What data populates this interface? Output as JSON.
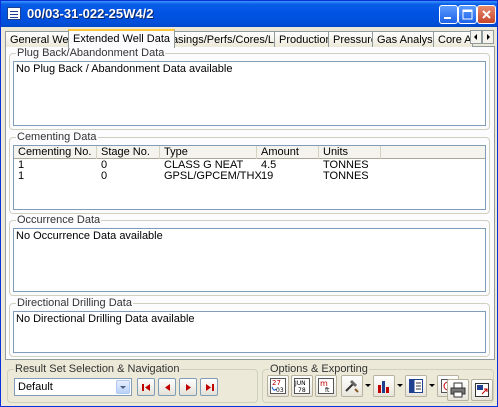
{
  "window": {
    "title": "00/03-31-022-25W4/2"
  },
  "tabs": [
    {
      "label": "General Well"
    },
    {
      "label": "Extended Well Data"
    },
    {
      "label": "Casings/Perfs/Cores/Logs"
    },
    {
      "label": "Production"
    },
    {
      "label": "Pressure"
    },
    {
      "label": "Gas Analysis"
    },
    {
      "label": "Core Ar"
    }
  ],
  "active_tab": "Extended Well Data",
  "plug_back": {
    "title": "Plug Back/Abandonment Data",
    "message": "No Plug Back / Abandonment Data available"
  },
  "cementing": {
    "title": "Cementing Data",
    "columns": [
      "Cementing No.",
      "Stage No.",
      "Type",
      "Amount",
      "Units"
    ],
    "rows": [
      [
        "1",
        "0",
        "CLASS G NEAT",
        "4.5",
        "TONNES"
      ],
      [
        "1",
        "0",
        "GPSL/GPCEM/THX",
        "19",
        "TONNES"
      ]
    ]
  },
  "occurrence": {
    "title": "Occurrence Data",
    "message": "No Occurrence Data available"
  },
  "directional": {
    "title": "Directional Drilling Data",
    "message": "No Directional Drilling Data available"
  },
  "navigation": {
    "title": "Result Set Selection & Navigation",
    "selected": "Default"
  },
  "options": {
    "title": "Options & Exporting",
    "calendar_a_top": "27",
    "calendar_a_bottom": "03",
    "calendar_b_top": "JUN",
    "calendar_b_bottom": "78",
    "calendar_c_top": "m",
    "calendar_c_bottom": "ft"
  },
  "colors": {
    "title_bar": "#0054e3",
    "close_button": "#c8452a",
    "active_tab_accent": "#ffc83c",
    "nav_arrow": "#c00000"
  }
}
